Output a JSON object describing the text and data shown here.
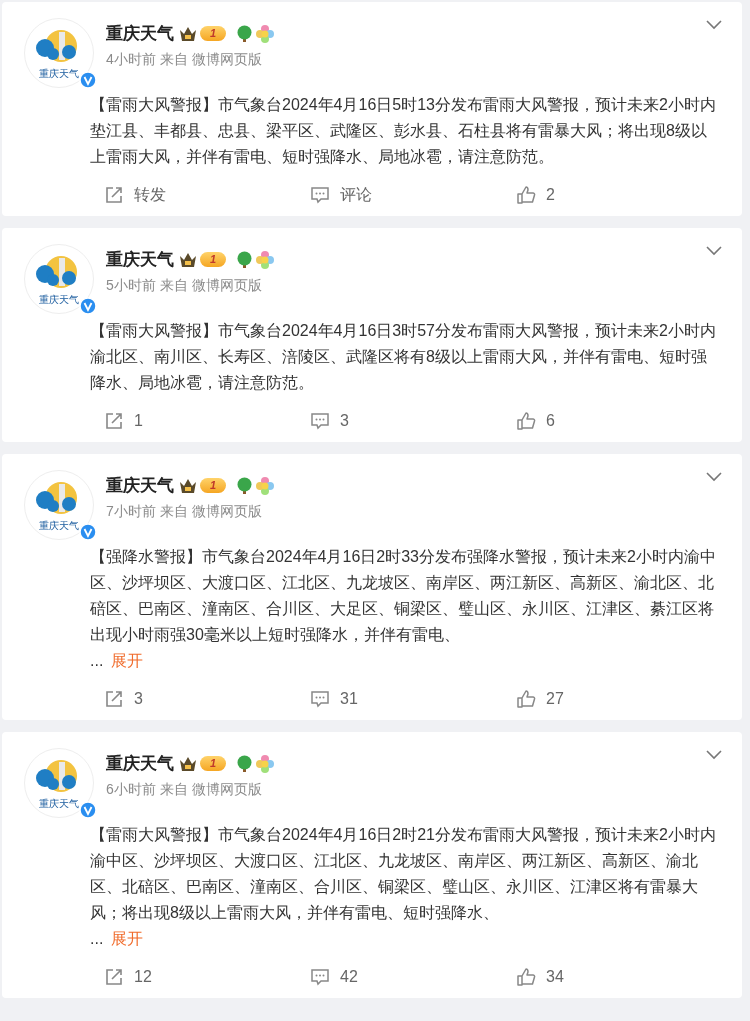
{
  "posts": [
    {
      "author": "重庆天气",
      "avatar_caption": "重庆天气",
      "level_badge": "1",
      "time": "4小时前",
      "source_prefix": "来自",
      "source": "微博网页版",
      "text": "【雷雨大风警报】市气象台2024年4月16日5时13分发布雷雨大风警报，预计未来2小时内垫江县、丰都县、忠县、梁平区、武隆区、彭水县、石柱县将有雷暴大风；将出现8级以上雷雨大风，并伴有雷电、短时强降水、局地冰雹，请注意防范。",
      "repost": "转发",
      "comment": "评论",
      "like": "2"
    },
    {
      "author": "重庆天气",
      "avatar_caption": "重庆天气",
      "level_badge": "1",
      "time": "5小时前",
      "source_prefix": "来自",
      "source": "微博网页版",
      "text": "【雷雨大风警报】市气象台2024年4月16日3时57分发布雷雨大风警报，预计未来2小时内渝北区、南川区、长寿区、涪陵区、武隆区将有8级以上雷雨大风，并伴有雷电、短时强降水、局地冰雹，请注意防范。",
      "repost": "1",
      "comment": "3",
      "like": "6"
    },
    {
      "author": "重庆天气",
      "avatar_caption": "重庆天气",
      "level_badge": "1",
      "time": "7小时前",
      "source_prefix": "来自",
      "source": "微博网页版",
      "text": "【强降水警报】市气象台2024年4月16日2时33分发布强降水警报，预计未来2小时内渝中区、沙坪坝区、大渡口区、江北区、九龙坡区、南岸区、两江新区、高新区、渝北区、北碚区、巴南区、潼南区、合川区、大足区、铜梁区、璧山区、永川区、江津区、綦江区将出现小时雨强30毫米以上短时强降水，并伴有雷电、",
      "ellipsis": "...",
      "expand": "展开",
      "repost": "3",
      "comment": "31",
      "like": "27"
    },
    {
      "author": "重庆天气",
      "avatar_caption": "重庆天气",
      "level_badge": "1",
      "time": "6小时前",
      "source_prefix": "来自",
      "source": "微博网页版",
      "text": "【雷雨大风警报】市气象台2024年4月16日2时21分发布雷雨大风警报，预计未来2小时内渝中区、沙坪坝区、大渡口区、江北区、九龙坡区、南岸区、两江新区、高新区、渝北区、北碚区、巴南区、潼南区、合川区、铜梁区、璧山区、永川区、江津区将有雷暴大风；将出现8级以上雷雨大风，并伴有雷电、短时强降水、",
      "ellipsis": "...",
      "expand": "展开",
      "repost": "12",
      "comment": "42",
      "like": "34"
    }
  ]
}
